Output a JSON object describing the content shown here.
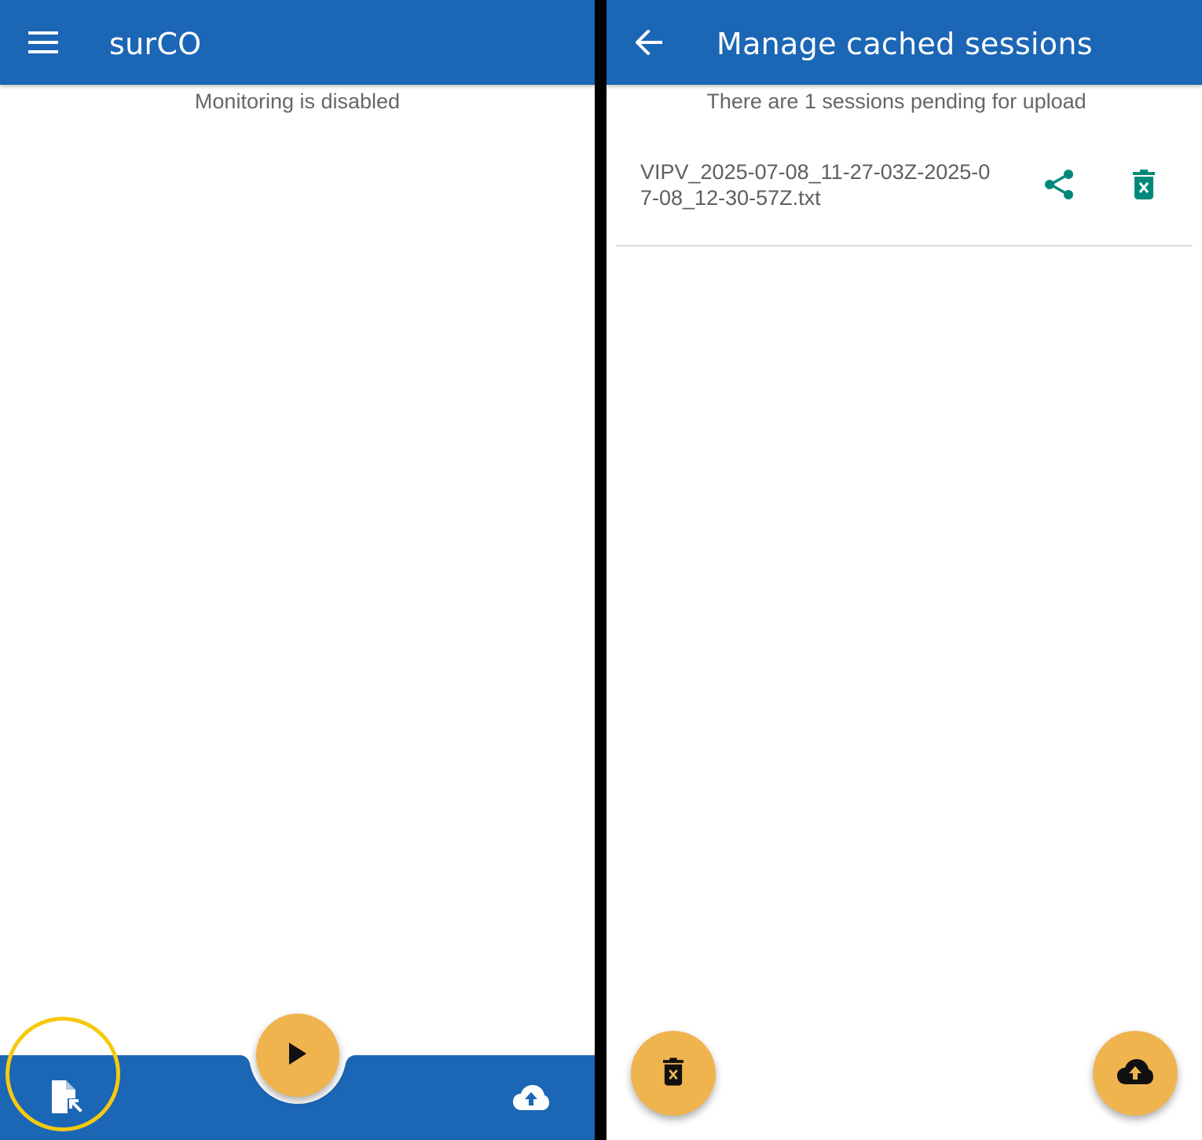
{
  "main_screen": {
    "app_title": "surCO",
    "status_text": "Monitoring is disabled",
    "icons": {
      "menu": "hamburger-menu-icon",
      "sessions": "file-open-icon",
      "play": "play-icon",
      "upload": "cloud-upload-icon"
    }
  },
  "cached_screen": {
    "title": "Manage cached sessions",
    "pending_text": "There are 1 sessions pending for upload",
    "sessions": [
      {
        "filename": "VIPV_2025-07-08_11-27-03Z-2025-07-08_12-30-57Z.txt"
      }
    ],
    "icons": {
      "back": "arrow-back-icon",
      "share": "share-icon",
      "delete": "delete-forever-icon",
      "delete_all": "delete-forever-icon",
      "upload_all": "cloud-upload-icon"
    }
  },
  "colors": {
    "appbar": "#1b66b5",
    "fab": "#f0b44f",
    "accent_teal": "#00897b",
    "highlight": "#f6c90e",
    "divider": "#000000"
  }
}
